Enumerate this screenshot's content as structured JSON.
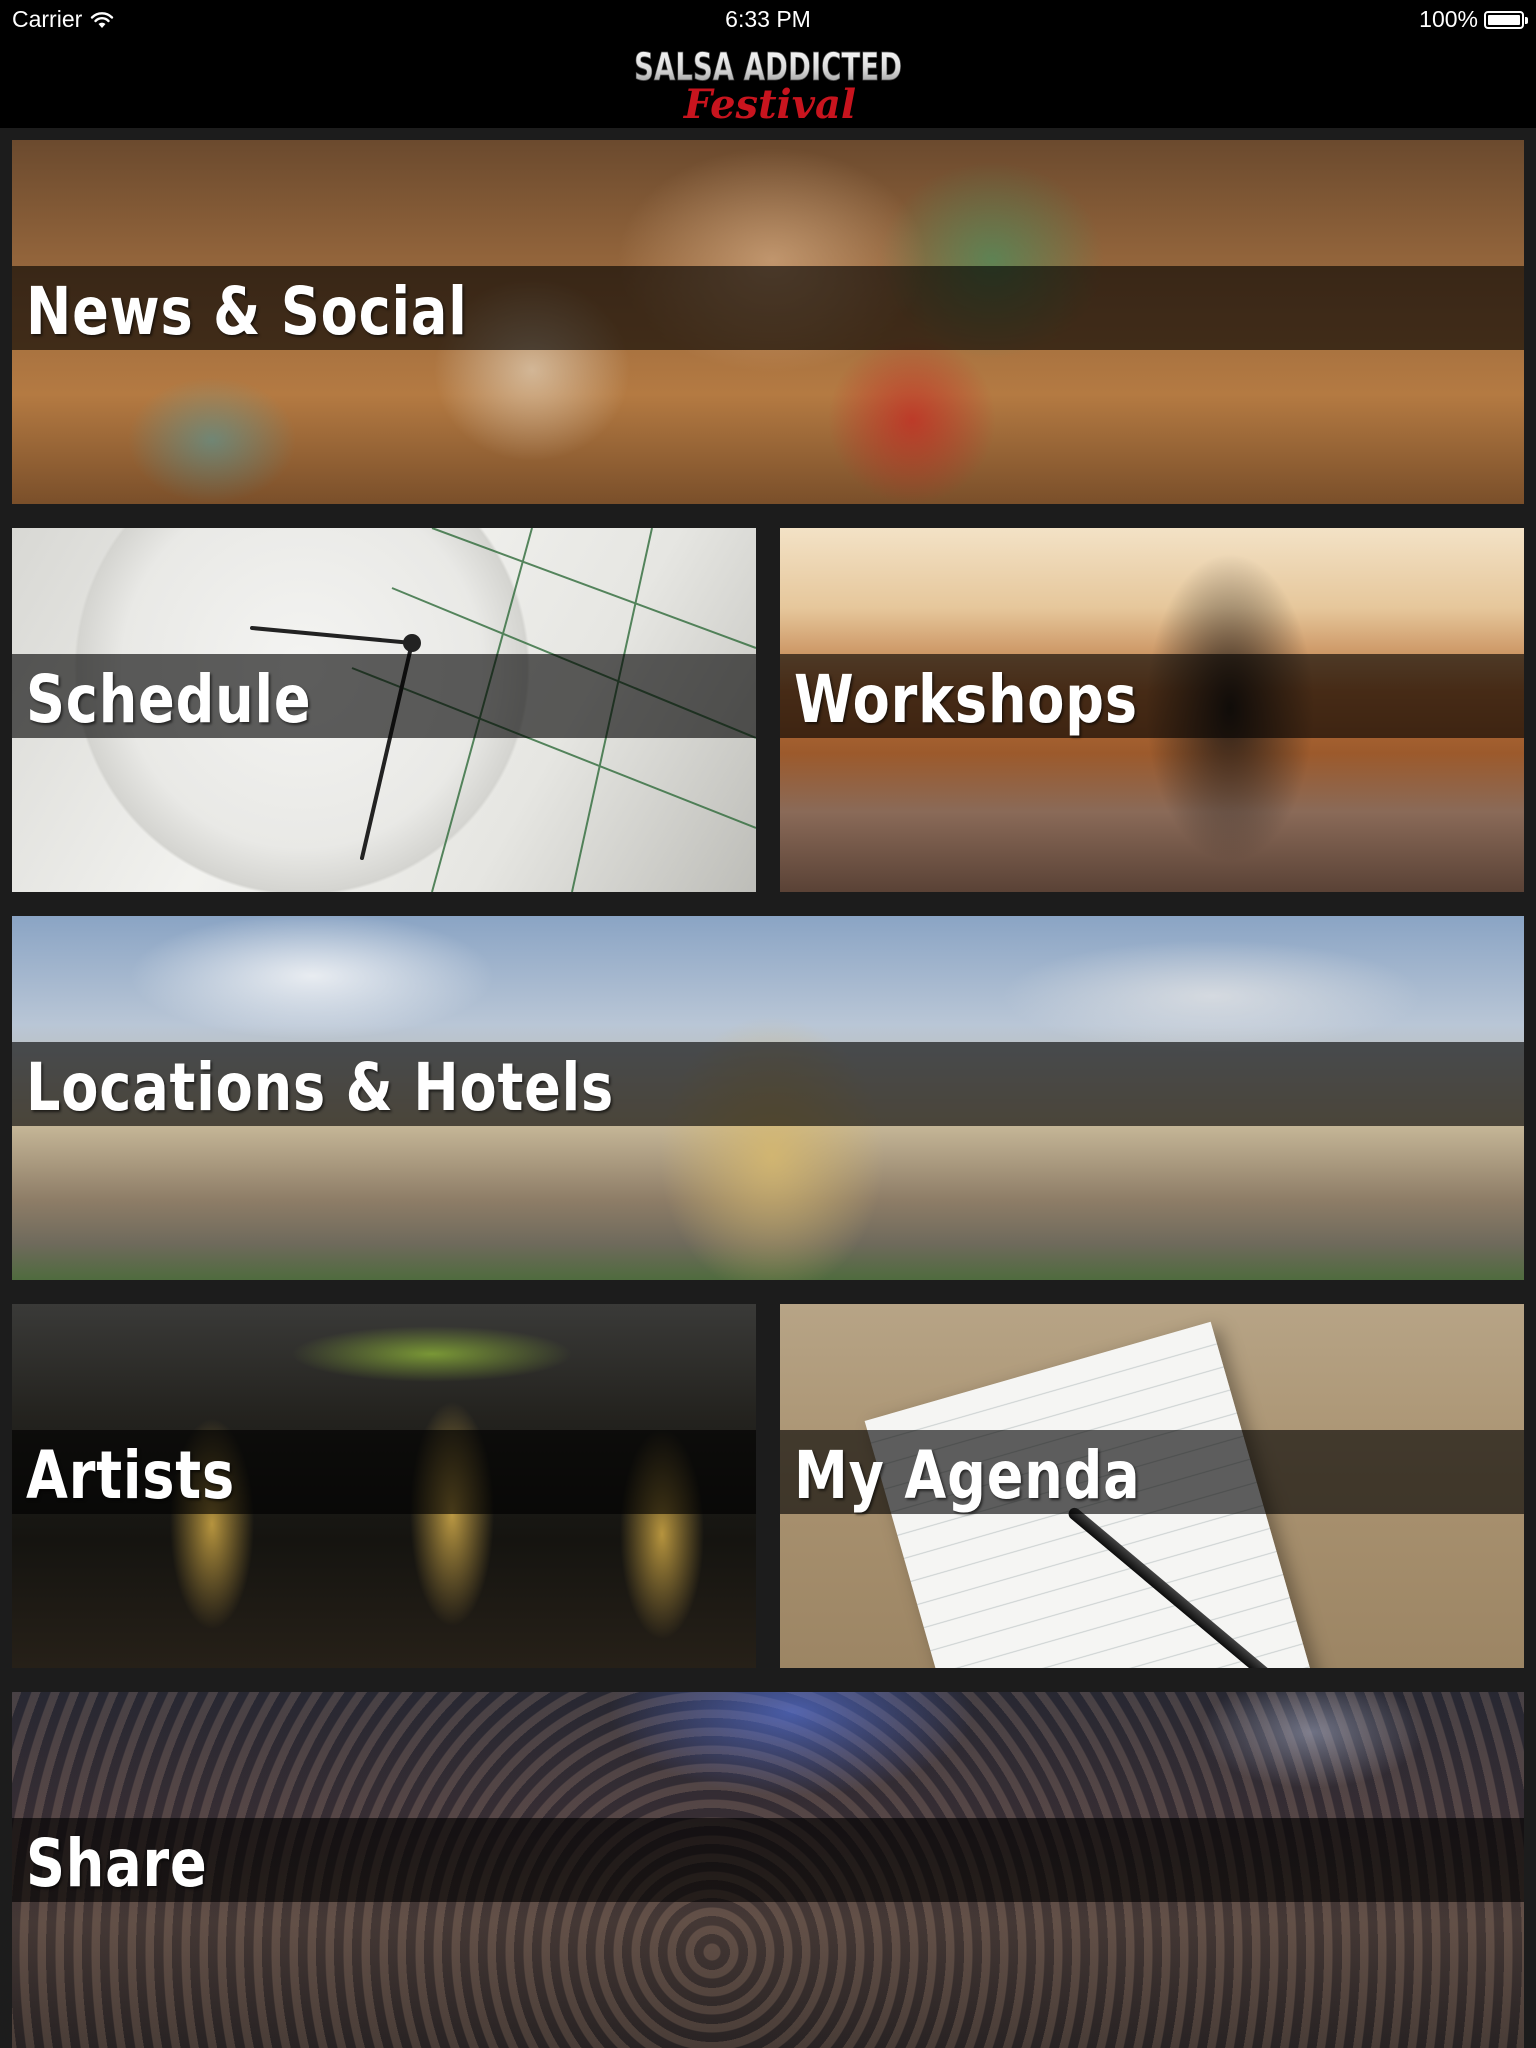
{
  "status_bar": {
    "carrier": "Carrier",
    "time": "6:33 PM",
    "battery": "100%"
  },
  "header": {
    "logo_line1": "SALSA ADDICTED",
    "logo_line2": "Festival"
  },
  "tiles": [
    {
      "id": "news",
      "label": "News & Social"
    },
    {
      "id": "schedule",
      "label": "Schedule"
    },
    {
      "id": "workshops",
      "label": "Workshops"
    },
    {
      "id": "locations",
      "label": "Locations & Hotels"
    },
    {
      "id": "artists",
      "label": "Artists"
    },
    {
      "id": "agenda",
      "label": "My Agenda"
    },
    {
      "id": "share",
      "label": "Share"
    }
  ],
  "colors": {
    "nav_background": "#000000",
    "grid_background": "#1c1c1c",
    "logo_red": "#c8141e"
  },
  "icons": [
    "wifi-icon",
    "battery-icon"
  ]
}
